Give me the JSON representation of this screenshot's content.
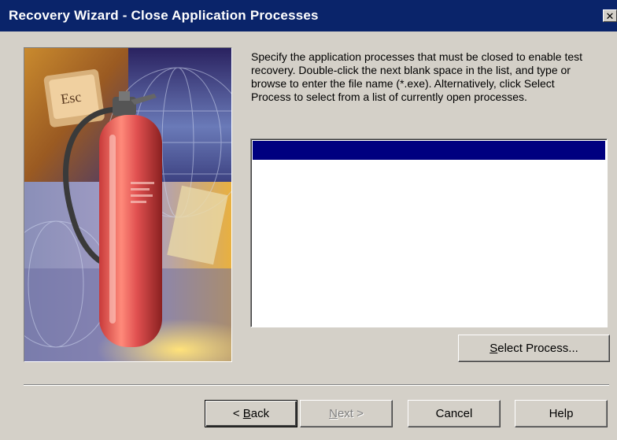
{
  "window": {
    "title": "Recovery Wizard - Close Application Processes",
    "close_glyph": "✕"
  },
  "picture": {
    "icon": "fire-extinguisher-illustration",
    "key_label": "Esc"
  },
  "instructions": {
    "text": "Specify the application processes that must be closed to enable test recovery. Double-click the next blank space in the list, and type or browse to enter the file name (*.exe). Alternatively, click Select Process to select from a list of currently open processes."
  },
  "process_list": {
    "rows": [
      ""
    ],
    "selected_index": 0
  },
  "buttons": {
    "select_process": {
      "mnemonic": "S",
      "rest": "elect Process..."
    },
    "back": {
      "prefix": "< ",
      "mnemonic": "B",
      "rest": "ack"
    },
    "next": {
      "mnemonic": "N",
      "rest": "ext >"
    },
    "cancel": "Cancel",
    "help": "Help"
  },
  "colors": {
    "titlebar": "#0a246a",
    "selection": "#000080",
    "face": "#d4d0c8"
  }
}
